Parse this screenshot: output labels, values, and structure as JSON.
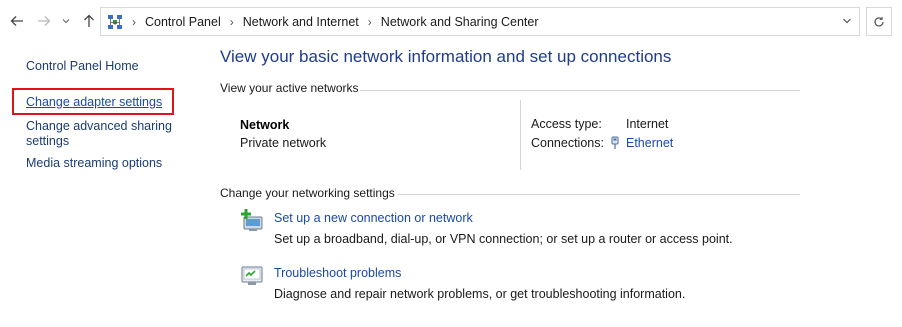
{
  "nav": {
    "back_icon": "arrow-left-icon",
    "forward_icon": "arrow-right-icon",
    "recent_icon": "chevron-down-icon",
    "up_icon": "arrow-up-icon",
    "breadcrumb": [
      "Control Panel",
      "Network and Internet",
      "Network and Sharing Center"
    ],
    "refresh_icon": "refresh-icon"
  },
  "sidebar": {
    "items": [
      {
        "label": "Control Panel Home"
      },
      {
        "label": "Change adapter settings"
      },
      {
        "label": "Change advanced sharing"
      },
      {
        "label": "settings"
      },
      {
        "label": "Media streaming options"
      }
    ],
    "highlight_color": "#e0121a"
  },
  "main": {
    "title": "View your basic network information and set up connections",
    "active_networks_label": "View your active networks",
    "network": {
      "name": "Network",
      "type": "Private network",
      "access_type_label": "Access type:",
      "access_type_value": "Internet",
      "connections_label": "Connections:",
      "connections_value": "Ethernet"
    },
    "settings_label": "Change your networking settings",
    "tasks": [
      {
        "icon": "new-connection-icon",
        "link": "Set up a new connection or network",
        "desc": "Set up a broadband, dial-up, or VPN connection; or set up a router or access point."
      },
      {
        "icon": "troubleshoot-icon",
        "link": "Troubleshoot problems",
        "desc": "Diagnose and repair network problems, or get troubleshooting information."
      }
    ]
  },
  "colors": {
    "link": "#1a4aa8",
    "title": "#1e3c88",
    "highlight": "#e0121a"
  }
}
